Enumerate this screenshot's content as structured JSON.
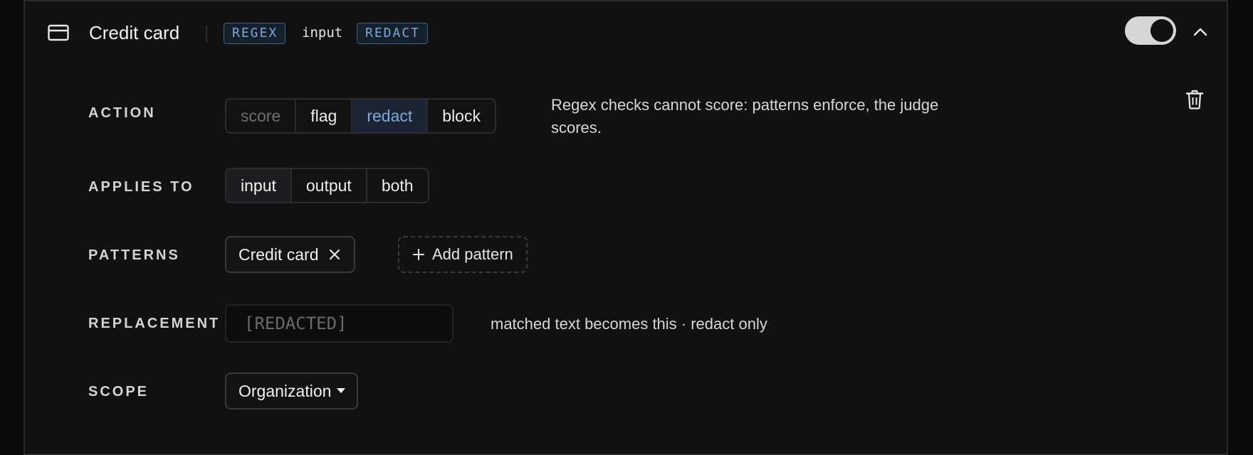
{
  "header": {
    "title": "Credit card",
    "tag_type": "REGEX",
    "direction": "input",
    "tag_action": "REDACT",
    "enabled": true,
    "expanded": true
  },
  "rows": {
    "action": {
      "label": "ACTION",
      "options": [
        "score",
        "flag",
        "redact",
        "block"
      ],
      "selected": "redact",
      "disabled": [
        "score"
      ],
      "hint": "Regex checks cannot score: patterns enforce, the judge scores."
    },
    "applies_to": {
      "label": "APPLIES TO",
      "options": [
        "input",
        "output",
        "both"
      ],
      "selected": "input"
    },
    "patterns": {
      "label": "PATTERNS",
      "items": [
        "Credit card"
      ],
      "add_label": "Add pattern"
    },
    "replacement": {
      "label": "REPLACEMENT",
      "placeholder": "[REDACTED]",
      "value": "",
      "hint": "matched text becomes this · redact only"
    },
    "scope": {
      "label": "SCOPE",
      "value": "Organization"
    }
  },
  "colors": {
    "accent_blue": "#7aa6d8",
    "background": "#111112"
  },
  "icons": {
    "card": "credit-card-icon",
    "toggle": "toggle-switch",
    "collapse": "chevron-up-icon",
    "delete": "trash-icon",
    "remove_chip": "close-icon",
    "add": "plus-icon",
    "dropdown": "caret-down-icon"
  }
}
